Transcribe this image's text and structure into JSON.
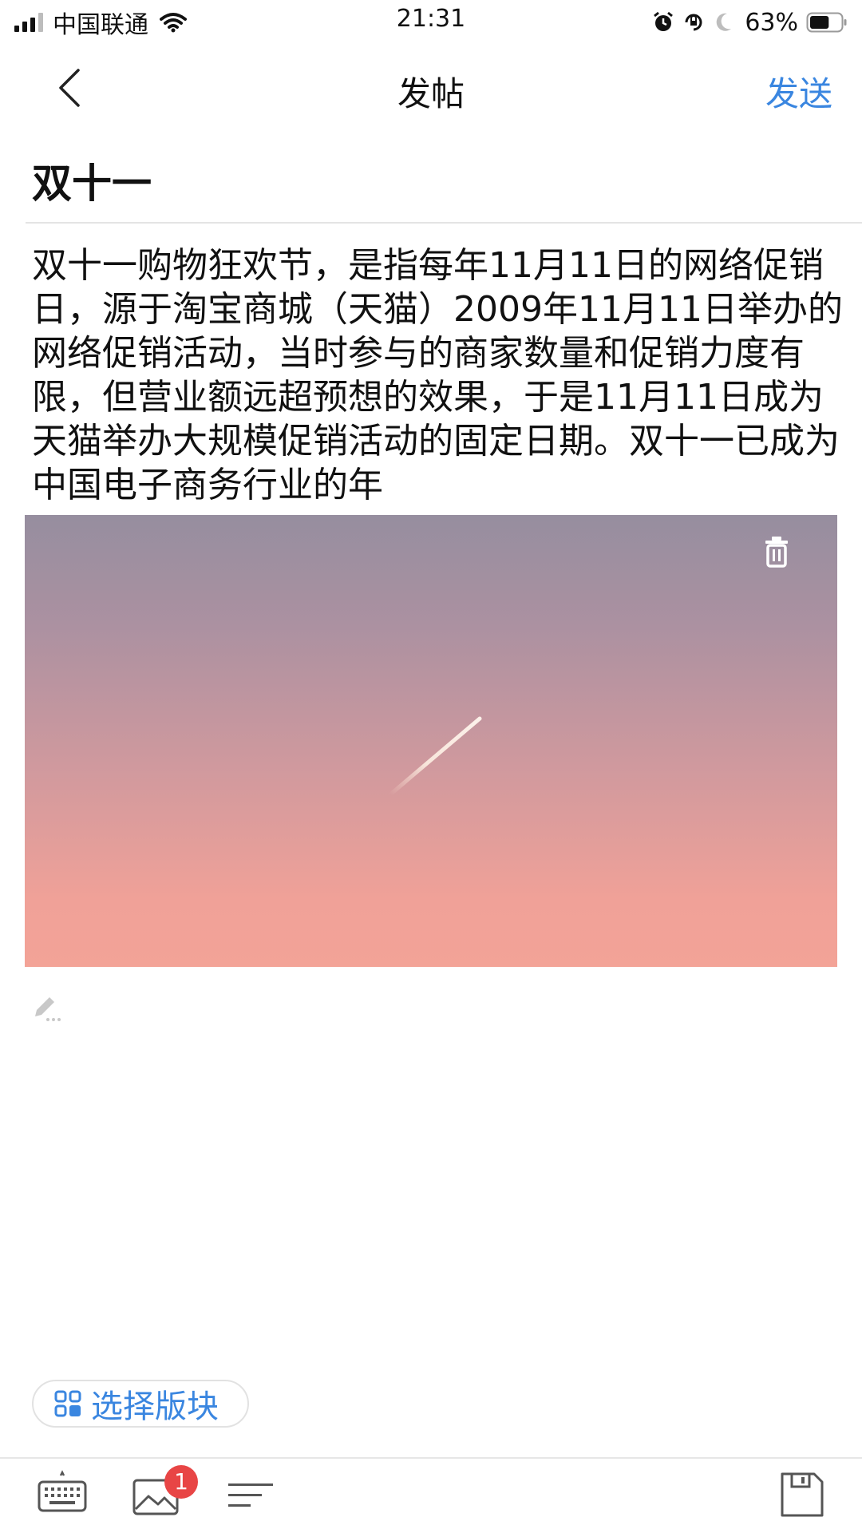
{
  "status_bar": {
    "carrier": "中国联通",
    "time": "21:31",
    "battery_percent": "63%",
    "battery_level": 0.63,
    "icons": [
      "signal-icon",
      "wifi-icon",
      "alarm-icon",
      "orientation-lock-icon",
      "moon-icon",
      "battery-icon"
    ]
  },
  "nav": {
    "title": "发帖",
    "send_label": "发送",
    "back_icon": "chevron-left-icon"
  },
  "post": {
    "title": "双十一",
    "body": "双十一购物狂欢节，是指每年11月11日的网络促销日，源于淘宝商城（天猫）2009年11月11日举办的网络促销活动，当时参与的商家数量和促销力度有限，但营业额远超预想的效果，于是11月11日成为天猫举办大规模促销活动的固定日期。双十一已成为中国电子商务行业的年"
  },
  "attachment": {
    "delete_icon": "trash-icon"
  },
  "section_selector": {
    "label": "选择版块"
  },
  "toolbar": {
    "items": [
      "keyboard-icon",
      "image-icon",
      "list-icon",
      "save-draft-icon"
    ],
    "image_badge": "1"
  },
  "colors": {
    "accent": "#3a86e0",
    "badge": "#e84545",
    "sky_top": "#968e9f",
    "sky_bottom": "#f3a397"
  }
}
